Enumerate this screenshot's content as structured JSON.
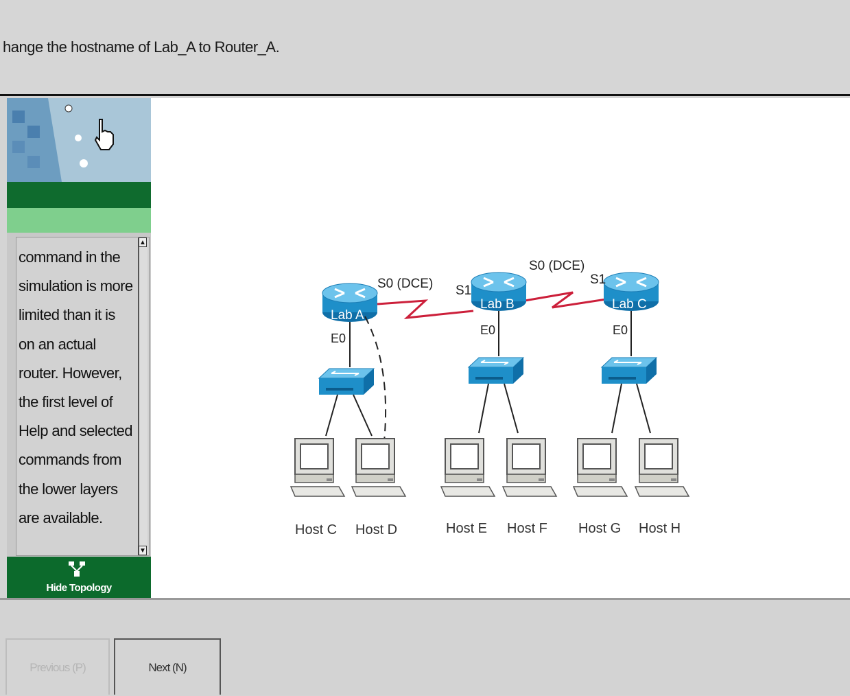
{
  "header": {
    "instruction": "hange the hostname of Lab_A to Router_A."
  },
  "help": {
    "lines": [
      "command in the",
      "simulation is more",
      "limited than it is",
      "on an actual",
      "router. However,",
      "the first level of",
      "Help and selected",
      "commands from",
      "the lower layers",
      "are available."
    ]
  },
  "topology_toggle": {
    "label": "Hide Topology",
    "icon": "topology-icon"
  },
  "topology": {
    "routers": [
      "Lab A",
      "Lab B",
      "Lab C"
    ],
    "links": {
      "ab_s0": "S0 (DCE)",
      "ab_s1": "S1",
      "bc_s0": "S0 (DCE)",
      "bc_s1": "S1"
    },
    "lan_port": "E0",
    "hosts": [
      "Host C",
      "Host D",
      "Host E",
      "Host F",
      "Host G",
      "Host H"
    ],
    "colors": {
      "serial_link": "#cc1f3a",
      "device_blue": "#1e8fc9"
    }
  },
  "footer": {
    "prev_label": "Previous (P)",
    "next_label": "Next (N)"
  }
}
